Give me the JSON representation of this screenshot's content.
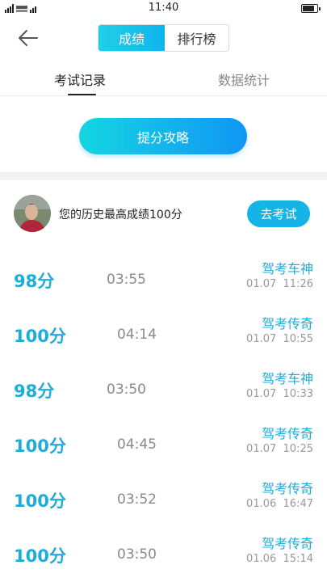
{
  "status_bar": {
    "time": "11:40",
    "battery_level": 0.75
  },
  "header": {
    "segments": [
      "成绩",
      "排行榜"
    ],
    "active_segment": "成绩"
  },
  "tabs": {
    "items": [
      "考试记录",
      "数据统计"
    ],
    "active": "考试记录"
  },
  "tips_button": {
    "label": "提分攻略"
  },
  "best_score": {
    "text": "您的历史最高成绩100分",
    "button_label": "去考试"
  },
  "records": [
    {
      "score": "98分",
      "duration": "03:55",
      "title": "驾考车神",
      "date": "01.07  11:26"
    },
    {
      "score": "100分",
      "duration": "04:14",
      "title": "驾考传奇",
      "date": "01.07  10:55"
    },
    {
      "score": "98分",
      "duration": "03:50",
      "title": "驾考车神",
      "date": "01.07  10:33"
    },
    {
      "score": "100分",
      "duration": "04:45",
      "title": "驾考传奇",
      "date": "01.07  10:25"
    },
    {
      "score": "100分",
      "duration": "03:52",
      "title": "驾考传奇",
      "date": "01.06  16:47"
    },
    {
      "score": "100分",
      "duration": "03:50",
      "title": "驾考传奇",
      "date": "01.06  15:14"
    }
  ],
  "colors": {
    "accent": "#1cadd8",
    "button_gradient_start": "#15d6e2",
    "button_gradient_end": "#1096f5"
  }
}
